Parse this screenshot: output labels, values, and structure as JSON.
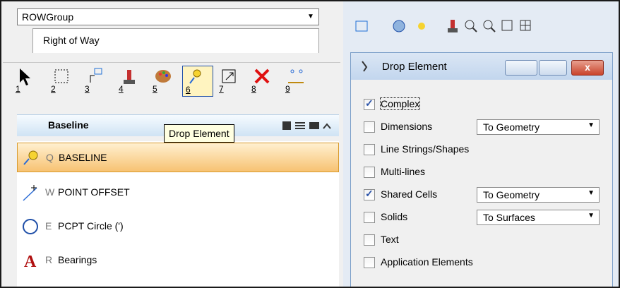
{
  "left": {
    "combo_value": "ROWGroup",
    "tab_label": "Right of Way",
    "tools": [
      {
        "num": "1",
        "icon": "arrow-cursor-icon"
      },
      {
        "num": "2",
        "icon": "dashed-selection-icon"
      },
      {
        "num": "3",
        "icon": "measure-icon"
      },
      {
        "num": "4",
        "icon": "bucket-icon"
      },
      {
        "num": "5",
        "icon": "palette-icon"
      },
      {
        "num": "6",
        "icon": "drop-element-icon"
      },
      {
        "num": "7",
        "icon": "scale-icon"
      },
      {
        "num": "8",
        "icon": "delete-icon"
      },
      {
        "num": "9",
        "icon": "offset-icon"
      }
    ],
    "group_header": "Baseline",
    "tooltip": "Drop Element",
    "items": [
      {
        "key": "Q",
        "label": "BASELINE"
      },
      {
        "key": "W",
        "label": "POINT OFFSET"
      },
      {
        "key": "E",
        "label": "PCPT Circle (')"
      },
      {
        "key": "R",
        "label": "Bearings"
      }
    ]
  },
  "dialog": {
    "title": "Drop Element",
    "options": [
      {
        "label": "Complex",
        "checked": true
      },
      {
        "label": "Dimensions",
        "checked": false,
        "select": "To Geometry"
      },
      {
        "label": "Line Strings/Shapes",
        "checked": false
      },
      {
        "label": "Multi-lines",
        "checked": false
      },
      {
        "label": "Shared Cells",
        "checked": true,
        "select": "To Geometry"
      },
      {
        "label": "Solids",
        "checked": false,
        "select": "To Surfaces"
      },
      {
        "label": "Text",
        "checked": false
      },
      {
        "label": "Application Elements",
        "checked": false
      }
    ]
  },
  "colors": {
    "accent": "#f7c272",
    "title": "#c2d6ee"
  }
}
